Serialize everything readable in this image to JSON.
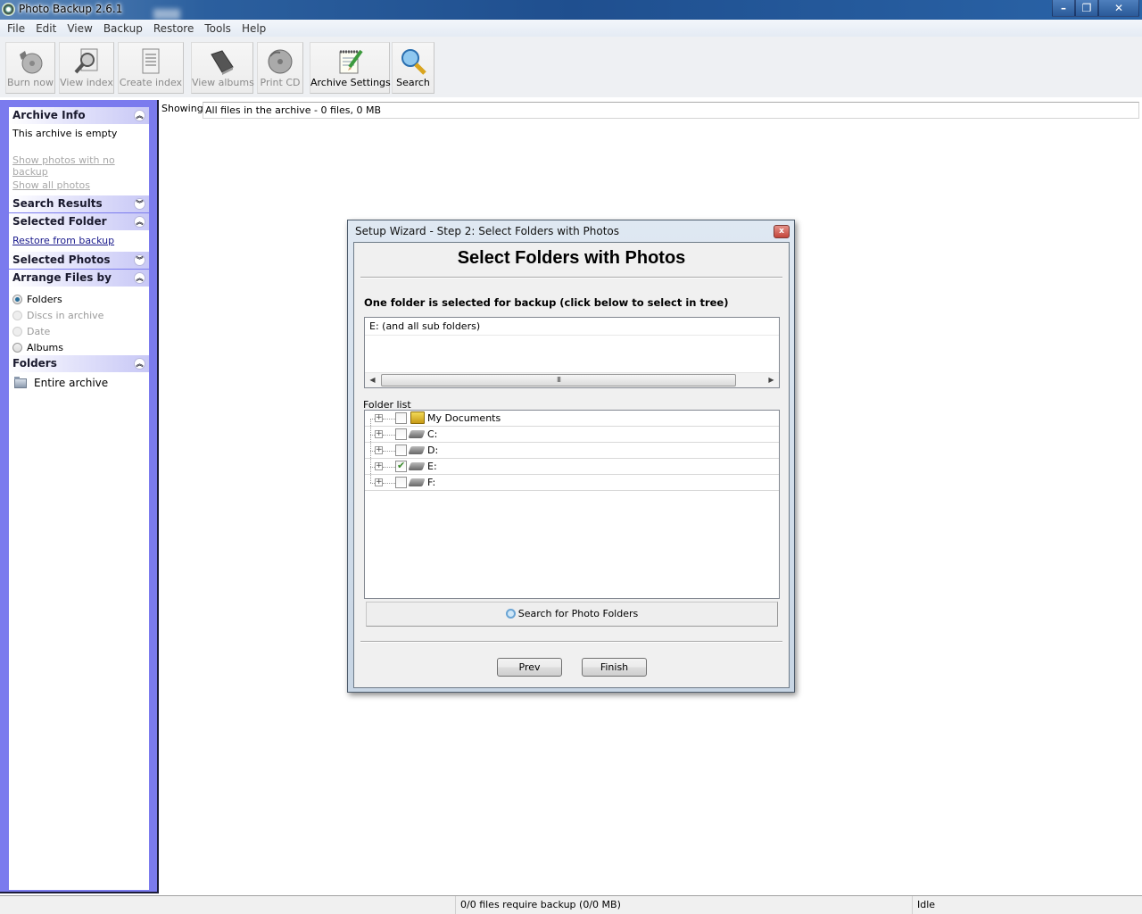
{
  "window": {
    "title": "Photo Backup 2.6.1",
    "controls": {
      "minimize": "–",
      "maximize": "❐",
      "close": "✕"
    }
  },
  "menu": [
    "File",
    "Edit",
    "View",
    "Backup",
    "Restore",
    "Tools",
    "Help"
  ],
  "toolbar": [
    {
      "label": "Burn now",
      "icon": "burn-cd-icon",
      "enabled": false
    },
    {
      "label": "View index",
      "icon": "view-index-icon",
      "enabled": false
    },
    {
      "label": "Create index",
      "icon": "create-index-icon",
      "enabled": false
    },
    {
      "label": "View albums",
      "icon": "album-book-icon",
      "enabled": false
    },
    {
      "label": "Print CD",
      "icon": "print-cd-icon",
      "enabled": false
    },
    {
      "label": "Archive Settings",
      "icon": "notepad-pencil-icon",
      "enabled": true
    },
    {
      "label": "Search",
      "icon": "magnifier-icon",
      "enabled": true
    }
  ],
  "sidebar": {
    "archive_info": {
      "title": "Archive Info",
      "text": "This archive is empty",
      "links": [
        "Show photos with no backup",
        "Show all photos"
      ]
    },
    "search_results": {
      "title": "Search Results"
    },
    "selected_folder": {
      "title": "Selected Folder",
      "link": "Restore from backup"
    },
    "selected_photos": {
      "title": "Selected Photos"
    },
    "arrange_files_by": {
      "title": "Arrange Files by",
      "options": [
        {
          "label": "Folders",
          "selected": true,
          "enabled": true
        },
        {
          "label": "Discs in archive",
          "selected": false,
          "enabled": false
        },
        {
          "label": "Date",
          "selected": false,
          "enabled": false
        },
        {
          "label": "Albums",
          "selected": false,
          "enabled": true
        }
      ]
    },
    "folders": {
      "title": "Folders",
      "items": [
        "Entire archive"
      ]
    }
  },
  "showing": {
    "label": "Showing",
    "value": "All files in the archive - 0 files, 0 MB"
  },
  "dialog": {
    "title": "Setup Wizard - Step 2: Select Folders with Photos",
    "heading": "Select Folders with Photos",
    "selection_label": "One folder is selected for backup (click below to select in tree)",
    "selected_items": [
      "E: (and all sub folders)"
    ],
    "scroll_thumb": "III",
    "folder_list_label": "Folder list",
    "folder_tree": [
      {
        "label": "My Documents",
        "type": "documents",
        "checked": false
      },
      {
        "label": "C:",
        "type": "drive",
        "checked": false
      },
      {
        "label": "D:",
        "type": "drive",
        "checked": false
      },
      {
        "label": "E:",
        "type": "drive",
        "checked": true
      },
      {
        "label": "F:",
        "type": "drive",
        "checked": false
      }
    ],
    "search_button": "Search for Photo Folders",
    "prev_button": "Prev",
    "finish_button": "Finish",
    "close_glyph": "x"
  },
  "status": {
    "backup": "0/0 files require backup (0/0 MB)",
    "state": "Idle"
  }
}
